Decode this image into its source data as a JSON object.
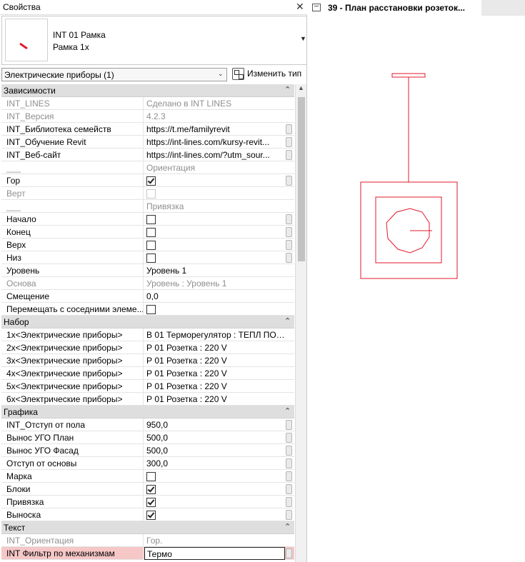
{
  "properties": {
    "title": "Свойства",
    "type_name": "INT 01 Рамка",
    "type_sub": "Рамка 1x",
    "filter_value": "Электрические приборы (1)",
    "edit_type_label": "Изменить тип"
  },
  "groups": [
    {
      "title": "Зависимости",
      "rows": [
        {
          "name": "INT_LINES",
          "value": "Сделано в INT LINES",
          "disabled": true
        },
        {
          "name": "INT_Версия",
          "value": "4.2.3",
          "disabled": true
        },
        {
          "name": "INT_Библиотека семейств",
          "value": "https://t.me/familyrevit",
          "btn": true
        },
        {
          "name": "INT_Обучение Revit",
          "value": "https://int-lines.com/kursy-revit...",
          "btn": true
        },
        {
          "name": "INT_Веб-сайт",
          "value": "https://int-lines.com/?utm_sour...",
          "btn": true
        },
        {
          "name": "___",
          "value": "Ориентация",
          "disabled": true
        },
        {
          "name": "Гор",
          "check": true,
          "btn": true
        },
        {
          "name": "Верт",
          "check": false,
          "disabled": true
        },
        {
          "name": "___",
          "value": "Привязка",
          "disabled": true
        },
        {
          "name": "Начало",
          "check": false,
          "btn": true
        },
        {
          "name": "Конец",
          "check": false,
          "btn": true
        },
        {
          "name": "Верх",
          "check": false,
          "btn": true
        },
        {
          "name": "Низ",
          "check": false,
          "btn": true
        },
        {
          "name": "Уровень",
          "value": "Уровень 1"
        },
        {
          "name": "Основа",
          "value": "Уровень : Уровень 1",
          "disabled": true
        },
        {
          "name": "Смещение",
          "value": "0,0"
        },
        {
          "name": "Перемещать с соседними элеме...",
          "check": false
        }
      ]
    },
    {
      "title": "Набор",
      "rows": [
        {
          "name": "1x<Электрические приборы>",
          "value": "В 01 Терморегулятор : ТЕПЛ ПОЛ..."
        },
        {
          "name": "2x<Электрические приборы>",
          "value": "Р 01 Розетка : 220 V"
        },
        {
          "name": "3x<Электрические приборы>",
          "value": "Р 01 Розетка : 220 V"
        },
        {
          "name": "4x<Электрические приборы>",
          "value": "Р 01 Розетка : 220 V"
        },
        {
          "name": "5x<Электрические приборы>",
          "value": "Р 01 Розетка : 220 V"
        },
        {
          "name": "6x<Электрические приборы>",
          "value": "Р 01 Розетка : 220 V"
        }
      ]
    },
    {
      "title": "Графика",
      "rows": [
        {
          "name": "INT_Отступ от пола",
          "value": "950,0",
          "btn": true
        },
        {
          "name": "Вынос УГО План",
          "value": "500,0",
          "btn": true
        },
        {
          "name": "Вынос УГО Фасад",
          "value": "500,0",
          "btn": true
        },
        {
          "name": "Отступ от основы",
          "value": "300,0",
          "btn": true
        },
        {
          "name": "Марка",
          "check": false,
          "btn": true
        },
        {
          "name": "Блоки",
          "check": true,
          "btn": true
        },
        {
          "name": "Привязка",
          "check": true,
          "btn": true
        },
        {
          "name": "Выноска",
          "check": true,
          "btn": true
        }
      ]
    },
    {
      "title": "Текст",
      "rows": [
        {
          "name": "INT_Ориентация",
          "value": "Гор.",
          "disabled": true
        },
        {
          "name": "INT Фильтр по механизмам",
          "value": "Термо",
          "highlight": true,
          "btn": true
        }
      ]
    }
  ],
  "view": {
    "tab_title": "39 - План расстановки розеток...",
    "line_color": "#e2182b"
  }
}
